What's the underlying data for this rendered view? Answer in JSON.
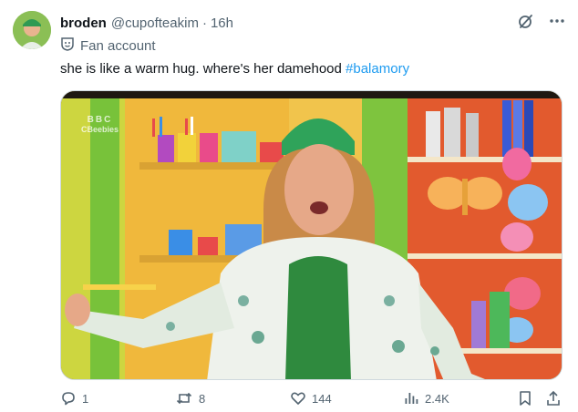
{
  "user": {
    "display_name": "broden",
    "handle": "@cupofteakim",
    "separator": "·",
    "time": "16h",
    "label": "Fan account"
  },
  "tweet": {
    "text": "she is like a warm hug. where's her damehood ",
    "hashtag": "#balamory"
  },
  "media": {
    "watermark_line1": "BBC",
    "watermark_line2": "CBeebies"
  },
  "actions": {
    "replies": "1",
    "reposts": "8",
    "likes": "144",
    "views": "2.4K"
  },
  "colors": {
    "accent": "#1d9bf0",
    "secondary_text": "#536471",
    "primary_text": "#0f1419"
  },
  "icons": [
    "grok-icon",
    "more-icon",
    "fan-account-icon",
    "reply-icon",
    "repost-icon",
    "like-icon",
    "views-icon",
    "bookmark-icon",
    "share-icon"
  ]
}
